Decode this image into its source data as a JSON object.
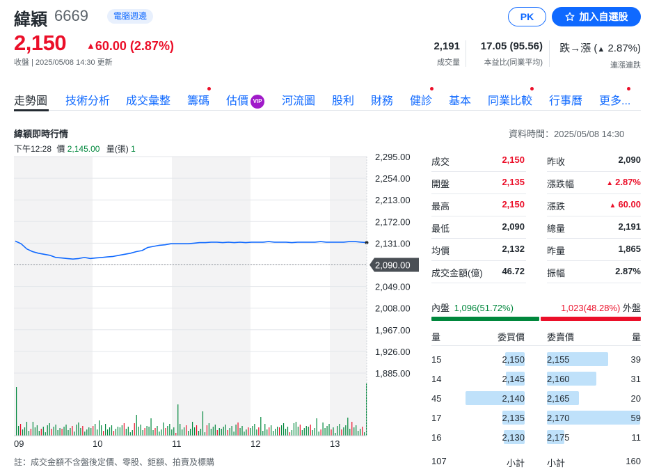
{
  "header": {
    "name": "緯穎",
    "code": "6669",
    "badge": "電腦週邊",
    "pk_label": "PK",
    "add_watchlist_label": "加入自選股",
    "price": "2,150",
    "change": "60.00 (2.87%)",
    "close_time": "收盤 | 2025/05/08 14:30 更新"
  },
  "stats": [
    {
      "value": "2,191",
      "label": "成交量"
    },
    {
      "value": "17.05 (95.56)",
      "label": "本益比(同業平均)"
    },
    {
      "value": "跌→漲 (",
      "value2": "2.87%)",
      "label": "連漲連跌"
    }
  ],
  "tabs": [
    "走勢圖",
    "技術分析",
    "成交彙整",
    "籌碼",
    "估價",
    "河流圖",
    "股利",
    "財務",
    "健診",
    "基本",
    "同業比較",
    "行事曆",
    "更多..."
  ],
  "vip_label": "VIP",
  "section": {
    "title": "緯穎即時行情",
    "data_time": "資料時間：2025/05/08 14:30",
    "hover_time": "下午12:28",
    "hover_price_label": "價",
    "hover_price": "2,145.00",
    "hover_vol_label": "量(張)",
    "hover_vol": "1",
    "footnote": "註：成交金額不含盤後定價、零股、鉅額、拍賣及標購"
  },
  "chart_data": {
    "type": "line",
    "x_labels": [
      "09",
      "10",
      "11",
      "12",
      "13"
    ],
    "y_ticks": [
      "2,295.00",
      "2,254.00",
      "2,213.00",
      "2,172.00",
      "2,131.00",
      "2,090.00",
      "2,049.00",
      "2,008.00",
      "1,967.00",
      "1,926.00",
      "1,885.00"
    ],
    "ylim": [
      1885,
      2295
    ],
    "ref_price": 2090,
    "ref_label": "2,090.00",
    "series": [
      {
        "values": [
          2135,
          2130,
          2120,
          2115,
          2112,
          2110,
          2108,
          2104,
          2103,
          2102,
          2101,
          2102,
          2104,
          2102,
          2103,
          2104,
          2105,
          2106,
          2108,
          2110,
          2112,
          2115,
          2117,
          2123,
          2125,
          2127,
          2128,
          2130,
          2130,
          2130,
          2130,
          2131,
          2132,
          2132,
          2133,
          2133,
          2132,
          2133,
          2132,
          2133,
          2132,
          2133,
          2133,
          2133,
          2134,
          2133,
          2133,
          2133,
          2132,
          2133,
          2133,
          2133,
          2133,
          2134,
          2133,
          2133,
          2133,
          2133,
          2134,
          2134,
          2133,
          2132
        ]
      }
    ]
  },
  "quote": [
    {
      "l1": "成交",
      "v1": "2,150",
      "c1": "red",
      "l2": "昨收",
      "v2": "2,090",
      "c2": "dark"
    },
    {
      "l1": "開盤",
      "v1": "2,135",
      "c1": "red",
      "l2": "漲跌幅",
      "v2": "2.87%",
      "c2": "red",
      "a2": true
    },
    {
      "l1": "最高",
      "v1": "2,150",
      "c1": "red",
      "l2": "漲跌",
      "v2": "60.00",
      "c2": "red",
      "a2": true
    },
    {
      "l1": "最低",
      "v1": "2,090",
      "c1": "dark",
      "l2": "總量",
      "v2": "2,191",
      "c2": "dark"
    },
    {
      "l1": "均價",
      "v1": "2,132",
      "c1": "dark",
      "l2": "昨量",
      "v2": "1,865",
      "c2": "dark"
    },
    {
      "l1": "成交金額(億)",
      "v1": "46.72",
      "c1": "dark",
      "l2": "振幅",
      "v2": "2.87%",
      "c2": "dark"
    }
  ],
  "inout": {
    "in_label": "內盤",
    "in_value": "1,096(51.72%)",
    "in_pct": 51.72,
    "out_value": "1,023(48.28%)",
    "out_label": "外盤",
    "in_color": "#00873c",
    "out_color": "#eb0f29"
  },
  "orderbook": {
    "h_qty": "量",
    "h_bid": "委買價",
    "h_ask": "委賣價",
    "h_qty2": "量",
    "rows": [
      {
        "bq": "15",
        "bp": "2,150",
        "ap": "2,155",
        "aq": "39",
        "bf": 0.25,
        "af": 0.66
      },
      {
        "bq": "14",
        "bp": "2,145",
        "ap": "2,160",
        "aq": "31",
        "bf": 0.24,
        "af": 0.53
      },
      {
        "bq": "45",
        "bp": "2,140",
        "ap": "2,165",
        "aq": "20",
        "bf": 0.76,
        "af": 0.34
      },
      {
        "bq": "17",
        "bp": "2,135",
        "ap": "2,170",
        "aq": "59",
        "bf": 0.29,
        "af": 1.0
      },
      {
        "bq": "16",
        "bp": "2,130",
        "ap": "2,175",
        "aq": "11",
        "bf": 0.27,
        "af": 0.19
      }
    ],
    "bid_total": "107",
    "sub_label": "小計",
    "sub_label2": "小計",
    "ask_total": "160"
  }
}
